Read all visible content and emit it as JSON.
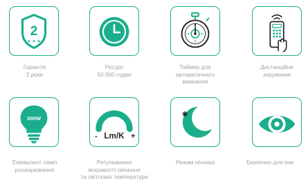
{
  "features": [
    {
      "icon": "shield-2-stars-icon",
      "badge": "2",
      "label": "Гарантія\n2 роки"
    },
    {
      "icon": "clock-icon",
      "label": "Ресурс\n50 000 годин"
    },
    {
      "icon": "stopwatch-icon",
      "label": "Таймер для\nавтоматичного\nвмикання"
    },
    {
      "icon": "remote-control-icon",
      "label": "Дистанційне\nкерування"
    },
    {
      "icon": "light-bulb-icon",
      "badge": "300W",
      "label": "Еквівалент ламп\nрозжарювання"
    },
    {
      "icon": "brightness-gauge-icon",
      "badge": "Lm/K",
      "minus": "-",
      "plus": "+",
      "label": "Регулювання\nяскравості свічення\nта світлової температури"
    },
    {
      "icon": "moon-star-icon",
      "label": "Режим нічника"
    },
    {
      "icon": "eye-icon",
      "label": "Безпечно для оче"
    }
  ],
  "colors": {
    "accent": "#1aae8c",
    "label_text": "#9ea2a6"
  }
}
